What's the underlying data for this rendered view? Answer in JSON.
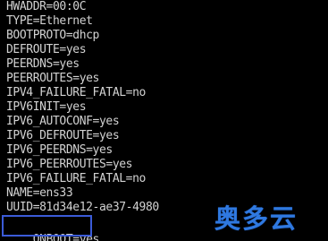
{
  "terminal": {
    "lines": [
      "HWADDR=00:0C",
      "TYPE=Ethernet",
      "BOOTPROTO=dhcp",
      "DEFROUTE=yes",
      "PEERDNS=yes",
      "PEERROUTES=yes",
      "IPV4_FAILURE_FATAL=no",
      "IPV6INIT=yes",
      "IPV6_AUTOCONF=yes",
      "IPV6_DEFROUTE=yes",
      "IPV6_PEERDNS=yes",
      "IPV6_PEERROUTES=yes",
      "IPV6_FAILURE_FATAL=no",
      "NAME=ens33",
      "UUID=81d34e12-ae37-4980",
      "ONBOOT=yes"
    ],
    "text_color": "#d2d2d2",
    "background_color": "#000000",
    "highlight_color": "#3b5bd8"
  },
  "watermark": {
    "text": "奥多云",
    "color": "#2f79e0"
  }
}
